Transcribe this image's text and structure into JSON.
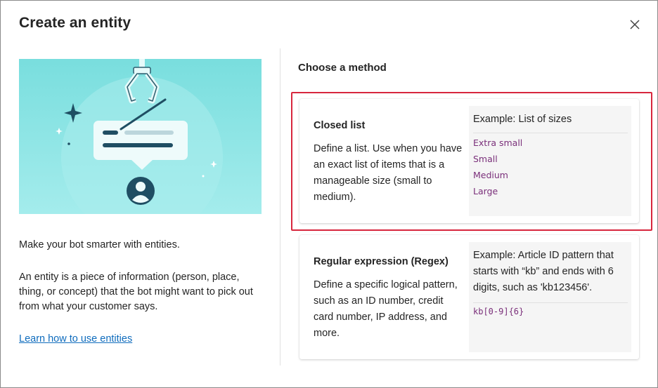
{
  "dialog": {
    "title": "Create an entity",
    "close_icon": "close-icon"
  },
  "left": {
    "illustration_icon": "robot-claw-message-illustration",
    "intro": "Make your bot smarter with entities.",
    "description": "An entity is a piece of information (person, place, thing, or concept) that the bot might want to pick out from what your customer says.",
    "learn_link": "Learn how to use entities"
  },
  "right": {
    "heading": "Choose a method",
    "cards": [
      {
        "title": "Closed list",
        "description": "Define a list. Use when you have an exact list of items that is a manageable size (small to medium).",
        "example_heading": "Example: List of sizes",
        "example_items": [
          "Extra small",
          "Small",
          "Medium",
          "Large"
        ]
      },
      {
        "title": "Regular expression (Regex)",
        "description": "Define a specific logical pattern, such as an ID number, credit card number, IP address, and more.",
        "example_heading": "Example: Article ID pattern that starts with “kb” and ends with 6 digits, such as 'kb123456'.",
        "example_pattern": "kb[0-9]{6}"
      }
    ]
  },
  "colors": {
    "highlight": "#d7263d",
    "link": "#0f6cbd",
    "example_text": "#7a2f7a",
    "illustration_bg": "#7fe0e0"
  }
}
